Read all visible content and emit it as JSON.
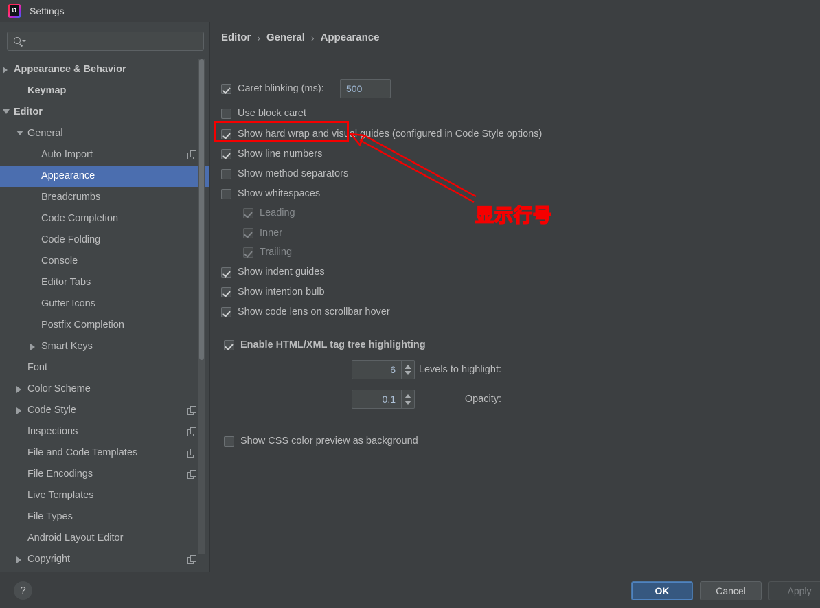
{
  "window": {
    "title": "Settings",
    "logo_icon": "intellij-idea-logo"
  },
  "sidebar": {
    "search": {
      "placeholder": "",
      "value": "",
      "icon": "search-icon"
    },
    "items": [
      {
        "label": "Appearance & Behavior",
        "indent": 0,
        "arrow": "collapsed",
        "bold": true,
        "selected": false,
        "badge": false
      },
      {
        "label": "Keymap",
        "indent": 1,
        "arrow": "none",
        "bold": true,
        "selected": false,
        "badge": false
      },
      {
        "label": "Editor",
        "indent": 0,
        "arrow": "expanded",
        "bold": true,
        "selected": false,
        "badge": false
      },
      {
        "label": "General",
        "indent": 1,
        "arrow": "expanded",
        "bold": false,
        "selected": false,
        "badge": false
      },
      {
        "label": "Auto Import",
        "indent": 2,
        "arrow": "none",
        "bold": false,
        "selected": false,
        "badge": true
      },
      {
        "label": "Appearance",
        "indent": 2,
        "arrow": "none",
        "bold": false,
        "selected": true,
        "badge": false
      },
      {
        "label": "Breadcrumbs",
        "indent": 2,
        "arrow": "none",
        "bold": false,
        "selected": false,
        "badge": false
      },
      {
        "label": "Code Completion",
        "indent": 2,
        "arrow": "none",
        "bold": false,
        "selected": false,
        "badge": false
      },
      {
        "label": "Code Folding",
        "indent": 2,
        "arrow": "none",
        "bold": false,
        "selected": false,
        "badge": false
      },
      {
        "label": "Console",
        "indent": 2,
        "arrow": "none",
        "bold": false,
        "selected": false,
        "badge": false
      },
      {
        "label": "Editor Tabs",
        "indent": 2,
        "arrow": "none",
        "bold": false,
        "selected": false,
        "badge": false
      },
      {
        "label": "Gutter Icons",
        "indent": 2,
        "arrow": "none",
        "bold": false,
        "selected": false,
        "badge": false
      },
      {
        "label": "Postfix Completion",
        "indent": 2,
        "arrow": "none",
        "bold": false,
        "selected": false,
        "badge": false
      },
      {
        "label": "Smart Keys",
        "indent": 2,
        "arrow": "collapsed",
        "bold": false,
        "selected": false,
        "badge": false
      },
      {
        "label": "Font",
        "indent": 1,
        "arrow": "none",
        "bold": false,
        "selected": false,
        "badge": false
      },
      {
        "label": "Color Scheme",
        "indent": 1,
        "arrow": "collapsed",
        "bold": false,
        "selected": false,
        "badge": false
      },
      {
        "label": "Code Style",
        "indent": 1,
        "arrow": "collapsed",
        "bold": false,
        "selected": false,
        "badge": true
      },
      {
        "label": "Inspections",
        "indent": 1,
        "arrow": "none",
        "bold": false,
        "selected": false,
        "badge": true
      },
      {
        "label": "File and Code Templates",
        "indent": 1,
        "arrow": "none",
        "bold": false,
        "selected": false,
        "badge": true
      },
      {
        "label": "File Encodings",
        "indent": 1,
        "arrow": "none",
        "bold": false,
        "selected": false,
        "badge": true
      },
      {
        "label": "Live Templates",
        "indent": 1,
        "arrow": "none",
        "bold": false,
        "selected": false,
        "badge": false
      },
      {
        "label": "File Types",
        "indent": 1,
        "arrow": "none",
        "bold": false,
        "selected": false,
        "badge": false
      },
      {
        "label": "Android Layout Editor",
        "indent": 1,
        "arrow": "none",
        "bold": false,
        "selected": false,
        "badge": false
      },
      {
        "label": "Copyright",
        "indent": 1,
        "arrow": "collapsed",
        "bold": false,
        "selected": false,
        "badge": true
      }
    ],
    "scrollbar": {
      "name": "sidebar-scrollbar"
    }
  },
  "main": {
    "breadcrumb": {
      "root": "Editor",
      "middle": "General",
      "leaf": "Appearance",
      "separator": "›"
    },
    "options": [
      {
        "id": "caret_blinking",
        "label": "Caret blinking (ms):",
        "checked": true,
        "disabled": false,
        "indent": 0
      },
      {
        "id": "use_block_caret",
        "label": "Use block caret",
        "checked": false,
        "disabled": false,
        "indent": 0
      },
      {
        "id": "show_hard_wrap",
        "label": "Show hard wrap and visual guides (configured in Code Style options)",
        "checked": true,
        "disabled": false,
        "indent": 0
      },
      {
        "id": "show_line_numbers",
        "label": "Show line numbers",
        "checked": true,
        "disabled": false,
        "indent": 0
      },
      {
        "id": "show_method_separators",
        "label": "Show method separators",
        "checked": false,
        "disabled": false,
        "indent": 0
      },
      {
        "id": "show_whitespaces",
        "label": "Show whitespaces",
        "checked": false,
        "disabled": false,
        "indent": 0
      },
      {
        "id": "ws_leading",
        "label": "Leading",
        "checked": true,
        "disabled": true,
        "indent": 1
      },
      {
        "id": "ws_inner",
        "label": "Inner",
        "checked": true,
        "disabled": true,
        "indent": 1
      },
      {
        "id": "ws_trailing",
        "label": "Trailing",
        "checked": true,
        "disabled": true,
        "indent": 1
      },
      {
        "id": "show_indent_guides",
        "label": "Show indent guides",
        "checked": true,
        "disabled": false,
        "indent": 0
      },
      {
        "id": "show_intention_bulb",
        "label": "Show intention bulb",
        "checked": true,
        "disabled": false,
        "indent": 0
      },
      {
        "id": "show_code_lens",
        "label": "Show code lens on scrollbar hover",
        "checked": true,
        "disabled": false,
        "indent": 0
      },
      {
        "id": "enable_html_xml",
        "label": "Enable HTML/XML tag tree highlighting",
        "checked": true,
        "disabled": false,
        "indent": 0
      },
      {
        "id": "show_css_color",
        "label": "Show CSS color preview as background",
        "checked": false,
        "disabled": false,
        "indent": 0
      }
    ],
    "caret_blinking_value": "500",
    "levels_label": "Levels to highlight:",
    "levels_value": "6",
    "opacity_label": "Opacity:",
    "opacity_value": "0.1"
  },
  "annotation": {
    "text": "显示行号",
    "color": "#f50000",
    "target": "show-line-numbers-checkbox"
  },
  "footer": {
    "help": "?",
    "ok": "OK",
    "cancel": "Cancel",
    "apply": "Apply",
    "apply_enabled": false
  }
}
